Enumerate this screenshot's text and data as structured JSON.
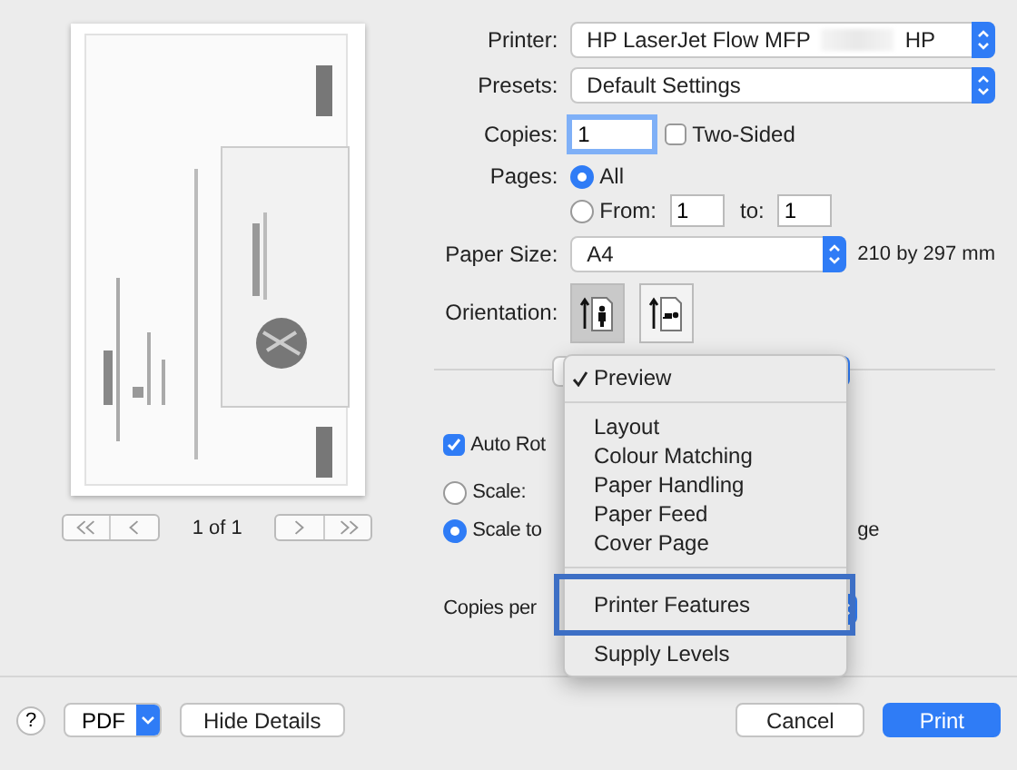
{
  "preview": {
    "page_counter": "1 of 1"
  },
  "printer": {
    "label": "Printer:",
    "value_start": "HP LaserJet Flow MFP",
    "value_end": "HP",
    "redacted": true
  },
  "presets": {
    "label": "Presets:",
    "value": "Default Settings"
  },
  "copies": {
    "label": "Copies:",
    "value": "1",
    "two_sided": {
      "label": "Two-Sided",
      "checked": false
    }
  },
  "pages": {
    "label": "Pages:",
    "options": [
      {
        "label": "All",
        "selected": true
      },
      {
        "label": "From:",
        "selected": false
      }
    ],
    "from": "1",
    "to_label": "to:",
    "to": "1"
  },
  "paper_size": {
    "label": "Paper Size:",
    "value": "A4",
    "dimensions": "210 by 297 mm"
  },
  "orientation": {
    "label": "Orientation:",
    "options": [
      {
        "kind": "portrait",
        "selected": true
      },
      {
        "kind": "landscape",
        "selected": false
      }
    ]
  },
  "auto_rotate": {
    "label": "Auto Rot",
    "checked": true
  },
  "scale_options": [
    {
      "label": "Scale:",
      "selected": false
    },
    {
      "label": "Scale to",
      "selected": true,
      "trailing": "ge"
    }
  ],
  "copies_per": {
    "label": "Copies per"
  },
  "section_menu": {
    "groups": [
      [
        {
          "label": "Preview",
          "checked": true,
          "highlighted": false
        }
      ],
      [
        {
          "label": "Layout",
          "checked": false,
          "highlighted": false
        },
        {
          "label": "Colour Matching",
          "checked": false,
          "highlighted": false
        },
        {
          "label": "Paper Handling",
          "checked": false,
          "highlighted": false
        },
        {
          "label": "Paper Feed",
          "checked": false,
          "highlighted": false
        },
        {
          "label": "Cover Page",
          "checked": false,
          "highlighted": false
        }
      ],
      [
        {
          "label": "Printer Features",
          "checked": false,
          "highlighted": true
        },
        {
          "label": "Supply Levels",
          "checked": false,
          "highlighted": false
        }
      ]
    ]
  },
  "footer": {
    "help": "?",
    "pdf": "PDF",
    "hide_details": "Hide Details",
    "cancel": "Cancel",
    "print": "Print"
  }
}
